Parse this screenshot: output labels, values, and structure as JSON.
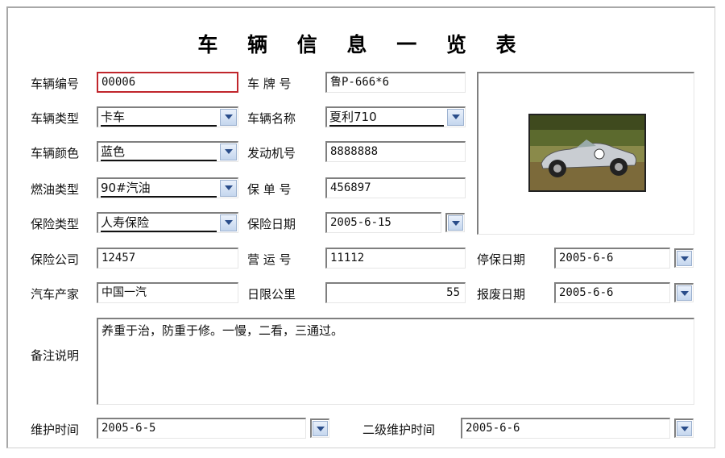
{
  "title": "车 辆 信 息 一 览 表",
  "fields": {
    "vehicle_no": {
      "label": "车辆编号",
      "value": "00006"
    },
    "plate_no": {
      "label": "车 牌 号",
      "value": "鲁P-666*6"
    },
    "vehicle_type": {
      "label": "车辆类型",
      "value": "卡车"
    },
    "vehicle_name": {
      "label": "车辆名称",
      "value": "夏利710"
    },
    "vehicle_color": {
      "label": "车辆颜色",
      "value": "蓝色"
    },
    "engine_no": {
      "label": "发动机号",
      "value": "8888888"
    },
    "fuel_type": {
      "label": "燃油类型",
      "value": "90#汽油"
    },
    "policy_no": {
      "label": "保 单 号",
      "value": "456897"
    },
    "insurance_type": {
      "label": "保险类型",
      "value": "人寿保险"
    },
    "insurance_date": {
      "label": "保险日期",
      "value": "2005-6-15"
    },
    "insurance_company": {
      "label": "保险公司",
      "value": "12457"
    },
    "operation_no": {
      "label": "营 运 号",
      "value": "11112"
    },
    "suspend_date": {
      "label": "停保日期",
      "value": "2005-6-6"
    },
    "manufacturer": {
      "label": "汽车产家",
      "value": "中国一汽"
    },
    "daily_km_limit": {
      "label": "日限公里",
      "value": "55"
    },
    "scrap_date": {
      "label": "报废日期",
      "value": "2005-6-6"
    },
    "remarks": {
      "label": "备注说明",
      "value": "养重于治，防重于修。一慢，二看，三通过。"
    },
    "maintenance_time": {
      "label": "维护时间",
      "value": "2005-6-5"
    },
    "secondary_maintenance_time": {
      "label": "二级维护时间",
      "value": "2005-6-6"
    }
  },
  "icons": {
    "dropdown": "chevron-down-icon"
  },
  "colors": {
    "active_border": "#c0262c",
    "button_blue": "#2a4d8a"
  }
}
